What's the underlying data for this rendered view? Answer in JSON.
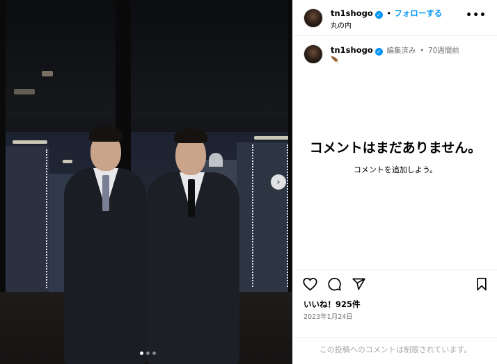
{
  "post": {
    "image_alt": "Two men in dark suits in front of night city window",
    "carousel_dots": 3,
    "carousel_active": 0,
    "next_icon": "chevron-right-icon",
    "next_glyph": "›"
  },
  "header": {
    "username": "tn1shogo",
    "verified_glyph": "✓",
    "separator": "•",
    "follow_label": "フォローする",
    "location": "丸の内",
    "more_glyph": "•••"
  },
  "caption": {
    "username": "tn1shogo",
    "verified_glyph": "✓",
    "edited_label": "編集済み",
    "separator": "•",
    "time_ago": "70週間前",
    "emoji": "🪶"
  },
  "comments": {
    "empty_title": "コメントはまだありません。",
    "empty_subtitle": "コメントを追加しよう。"
  },
  "actions": {
    "icons": [
      "heart-icon",
      "comment-icon",
      "share-icon",
      "bookmark-icon"
    ],
    "likes": "いいね！925件",
    "date": "2023年1月24日",
    "comments_restricted": "この投稿へのコメントは制限されています。"
  },
  "colors": {
    "accent": "#0095f6",
    "muted": "#737373",
    "border": "#efefef"
  }
}
